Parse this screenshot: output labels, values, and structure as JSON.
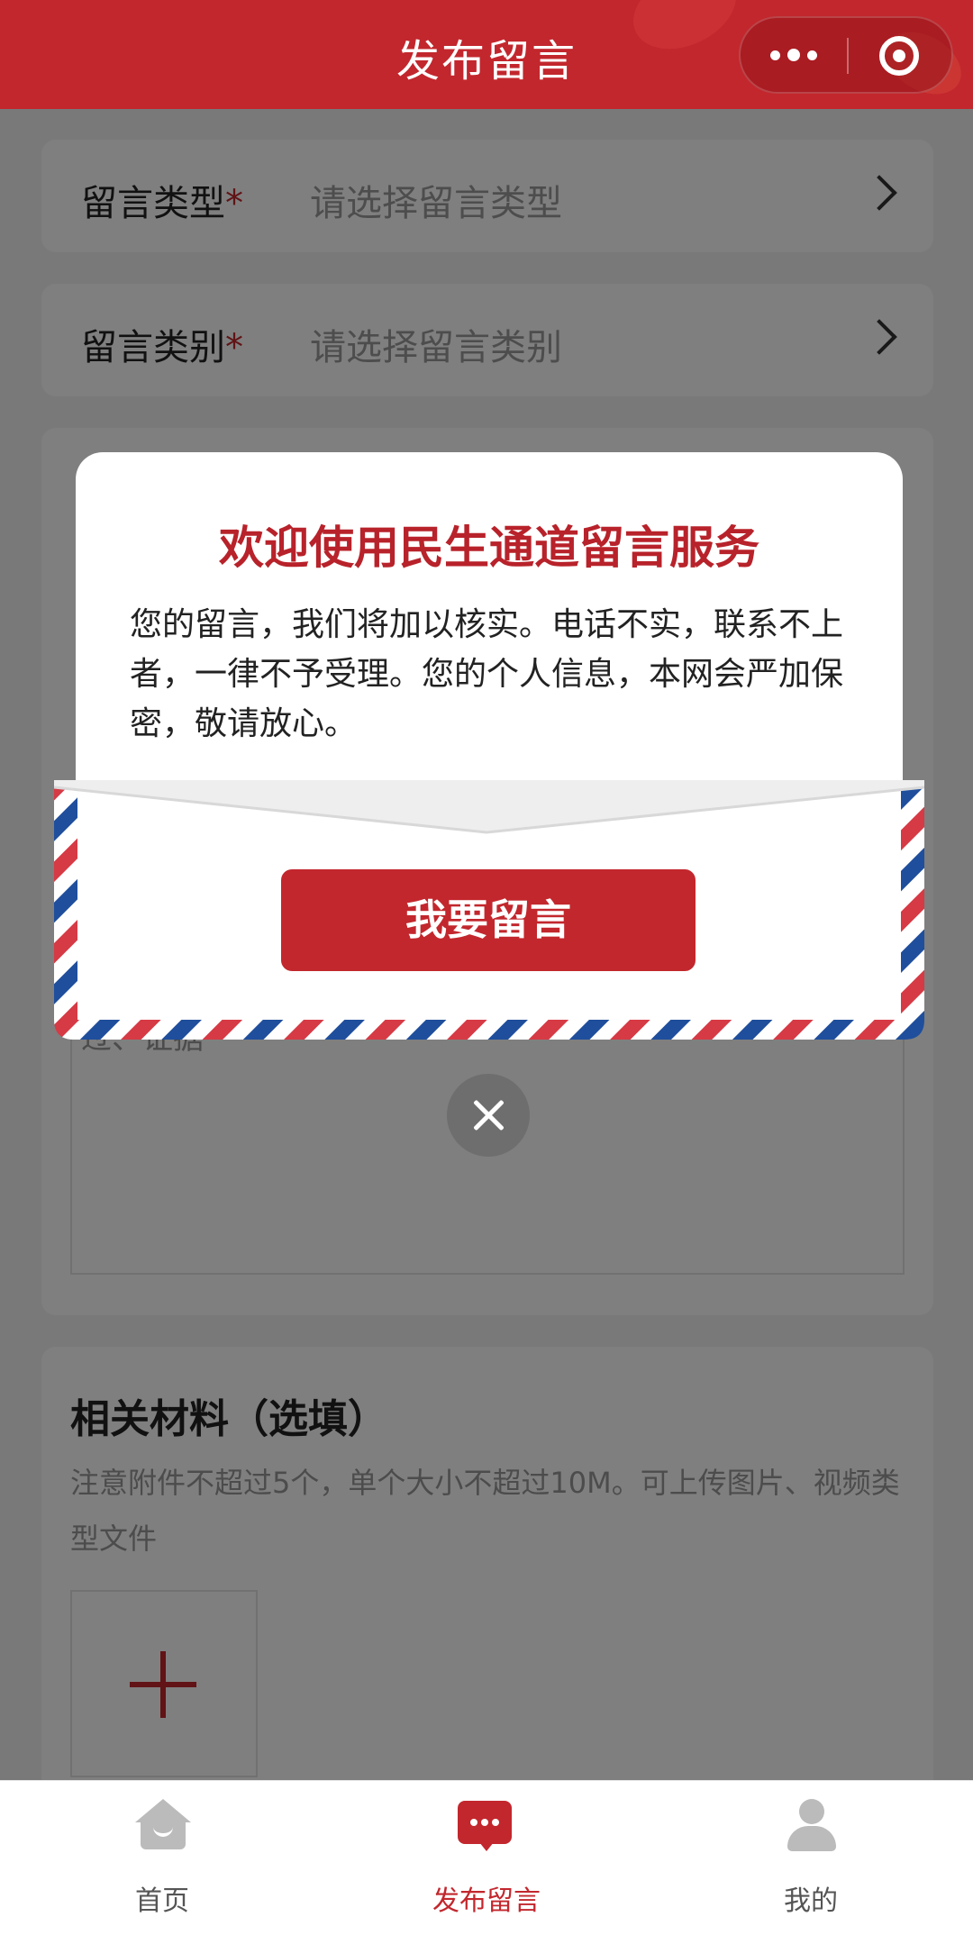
{
  "header": {
    "title": "发布留言"
  },
  "form": {
    "type": {
      "label": "留言类型",
      "required_mark": "*",
      "placeholder": "请选择留言类型"
    },
    "category": {
      "label": "留言类别",
      "required_mark": "*",
      "placeholder": "请选择留言类别"
    },
    "content_hint_tail": "过、证据"
  },
  "materials": {
    "title": "相关材料（选填）",
    "note": "注意附件不超过5个，单个大小不超过10M。可上传图片、视频类型文件"
  },
  "modal": {
    "title": "欢迎使用民生通道留言服务",
    "text": "您的留言，我们将加以核实。电话不实，联系不上者，一律不予受理。您的个人信息，本网会严加保密，敬请放心。",
    "button": "我要留言"
  },
  "tabbar": {
    "tabs": [
      {
        "label": "首页",
        "active": false
      },
      {
        "label": "发布留言",
        "active": true
      },
      {
        "label": "我的",
        "active": false
      }
    ]
  },
  "colors": {
    "brand": "#c2272d",
    "envelope_blue": "#1f4e9c"
  }
}
